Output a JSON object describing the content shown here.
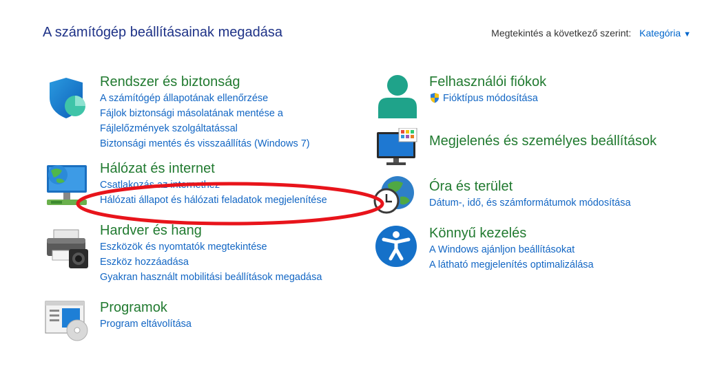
{
  "header": {
    "title": "A számítógép beállításainak megadása",
    "view_by_label": "Megtekintés a következő szerint:",
    "view_by_value": "Kategória"
  },
  "left_column": [
    {
      "title": "Rendszer és biztonság",
      "icon": "shield-icon",
      "links": [
        "A számítógép állapotának ellenőrzése",
        "Fájlok biztonsági másolatának mentése a",
        "Fájlelőzmények szolgáltatással",
        "Biztonsági mentés és visszaállítás (Windows 7)"
      ]
    },
    {
      "title": "Hálózat és internet",
      "icon": "network-icon",
      "links": [
        "Csatlakozás az internethez",
        "Hálózati állapot és hálózati feladatok megjelenítése"
      ]
    },
    {
      "title": "Hardver és hang",
      "icon": "printer-icon",
      "links": [
        "Eszközök és nyomtatók megtekintése",
        "Eszköz hozzáadása",
        "Gyakran használt mobilitási beállítások megadása"
      ]
    },
    {
      "title": "Programok",
      "icon": "programs-icon",
      "links": [
        "Program eltávolítása"
      ]
    }
  ],
  "right_column": [
    {
      "title": "Felhasználói fiókok",
      "icon": "user-icon",
      "links": [
        "Fióktípus módosítása"
      ]
    },
    {
      "title": "Megjelenés és személyes beállítások",
      "icon": "monitor-icon",
      "links": []
    },
    {
      "title": "Óra és terület",
      "icon": "clock-globe-icon",
      "links": [
        "Dátum-, idő, és számformátumok módosítása"
      ]
    },
    {
      "title": "Könnyű kezelés",
      "icon": "accessibility-icon",
      "links": [
        "A Windows ajánljon beállításokat",
        "A látható megjelenítés optimalizálása"
      ]
    }
  ],
  "colors": {
    "title_blue": "#1e3287",
    "category_green": "#217a30",
    "link_blue": "#1266c4",
    "annotation_red": "#e8141b"
  }
}
